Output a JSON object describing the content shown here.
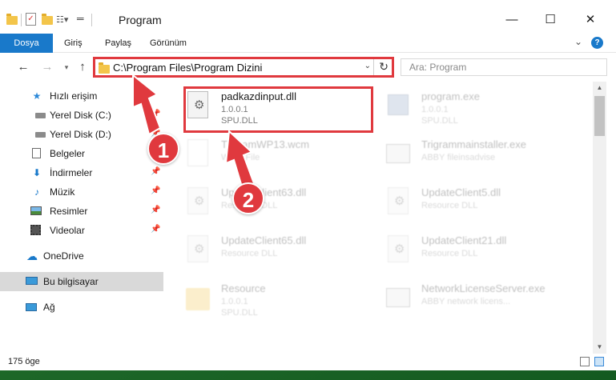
{
  "window": {
    "title": "Program",
    "minimize": "—",
    "maximize": "☐",
    "close": "✕"
  },
  "ribbon": {
    "tabs": [
      "Dosya",
      "Giriş",
      "Paylaş",
      "Görünüm"
    ],
    "help": "?",
    "expand": "⌄"
  },
  "address": {
    "path": "C:\\Program Files\\Program Dizini",
    "search_placeholder": "Ara: Program"
  },
  "sidebar": {
    "items": [
      {
        "label": "Hızlı erişim",
        "icon": "star-icon",
        "pinned": false
      },
      {
        "label": "Yerel Disk (C:)",
        "icon": "drive-icon",
        "pinned": true
      },
      {
        "label": "Yerel Disk (D:)",
        "icon": "drive-icon",
        "pinned": true
      },
      {
        "label": "Belgeler",
        "icon": "document-icon",
        "pinned": true
      },
      {
        "label": "İndirmeler",
        "icon": "download-icon",
        "pinned": true
      },
      {
        "label": "Müzik",
        "icon": "music-icon",
        "pinned": true
      },
      {
        "label": "Resimler",
        "icon": "picture-icon",
        "pinned": true
      },
      {
        "label": "Videolar",
        "icon": "video-icon",
        "pinned": true
      },
      {
        "label": "OneDrive",
        "icon": "cloud-icon",
        "pinned": false
      },
      {
        "label": "Bu bilgisayar",
        "icon": "computer-icon",
        "pinned": false
      },
      {
        "label": "Ağ",
        "icon": "network-icon",
        "pinned": false
      }
    ],
    "selected": "Bu bilgisayar"
  },
  "files": [
    {
      "name": "padkazdinput.dll",
      "meta1": "1.0.0.1",
      "meta2": "SPU.DLL",
      "highlighted": true
    },
    {
      "name": "program.exe",
      "meta1": "1.0.0.1",
      "meta2": "SPU.DLL",
      "highlighted": false
    },
    {
      "name": "Trigrammainstaller.exe",
      "meta1": "ABBY fileinsadvise",
      "meta2": "",
      "highlighted": false
    },
    {
      "name": "TrigramWP13.wcm",
      "meta1": "WCM File",
      "meta2": "",
      "highlighted": false
    },
    {
      "name": "UpdateClient63.dll",
      "meta1": "Resource DLL",
      "meta2": "",
      "highlighted": false
    },
    {
      "name": "UpdateClient5.dll",
      "meta1": "Resource DLL",
      "meta2": "",
      "highlighted": false
    },
    {
      "name": "UpdateClient65.dll",
      "meta1": "Resource DLL",
      "meta2": "",
      "highlighted": false
    },
    {
      "name": "UpdateClient21.dll",
      "meta1": "Resource DLL",
      "meta2": "",
      "highlighted": false
    },
    {
      "name": "Resource",
      "meta1": "1.0.0.1",
      "meta2": "SPU.DLL",
      "highlighted": false
    },
    {
      "name": "NetworkLicenseServer.exe",
      "meta1": "ABBY network licens...",
      "meta2": "",
      "highlighted": false
    }
  ],
  "status": {
    "count": "175 öge"
  },
  "annotations": {
    "step1": "1",
    "step2": "2",
    "color": "#e0393e"
  }
}
